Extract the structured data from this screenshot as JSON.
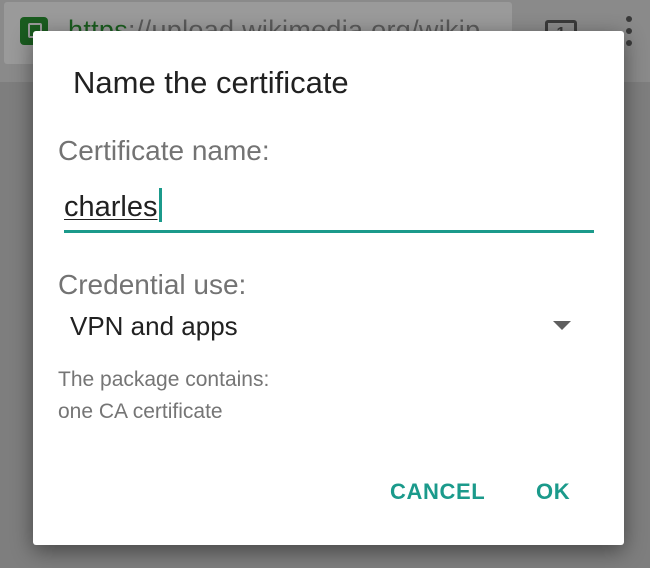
{
  "browser": {
    "url_scheme": "https",
    "url_rest": "://upload.wikimedia.org/wikip",
    "tab_count": "1",
    "lock_icon": "lock-icon",
    "menu_icon": "overflow-menu-icon"
  },
  "dialog": {
    "title": "Name the certificate",
    "name_label": "Certificate name:",
    "name_value": "charles",
    "use_label": "Credential use:",
    "use_value": "VPN and apps",
    "dropdown_icon": "dropdown-arrow-icon",
    "info_line1": "The package contains:",
    "info_line2": "one CA certificate",
    "cancel_label": "CANCEL",
    "ok_label": "OK"
  },
  "colors": {
    "accent": "#1b9a8b",
    "scrim": "#7e7e7e",
    "secure_green": "#1a5c1f"
  }
}
